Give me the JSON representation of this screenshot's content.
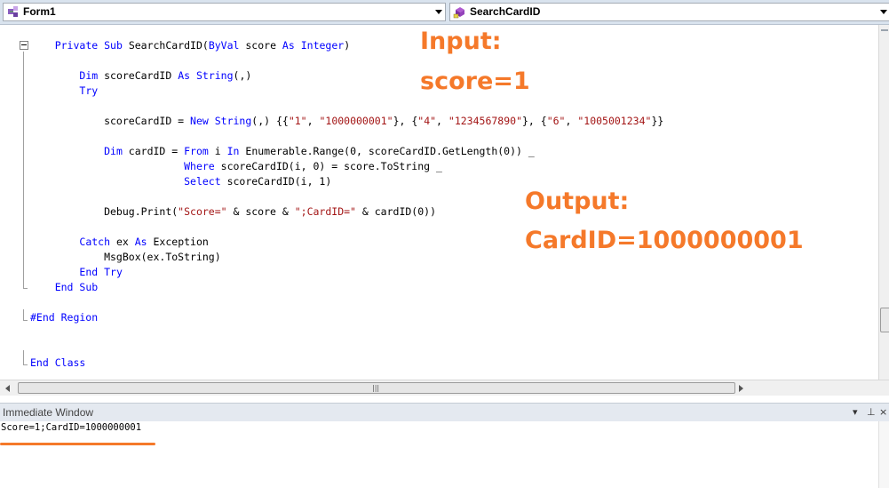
{
  "toolbar": {
    "class_combo": {
      "label": "Form1",
      "icon": "class-icon"
    },
    "method_combo": {
      "label": "SearchCardID",
      "icon": "method-icon"
    }
  },
  "code_lines": [
    [
      {
        "t": "    "
      },
      {
        "t": "Private",
        "c": "kw"
      },
      {
        "t": " "
      },
      {
        "t": "Sub",
        "c": "kw"
      },
      {
        "t": " SearchCardID("
      },
      {
        "t": "ByVal",
        "c": "kw"
      },
      {
        "t": " score "
      },
      {
        "t": "As",
        "c": "kw"
      },
      {
        "t": " "
      },
      {
        "t": "Integer",
        "c": "kw"
      },
      {
        "t": ")"
      }
    ],
    [],
    [
      {
        "t": "        "
      },
      {
        "t": "Dim",
        "c": "kw"
      },
      {
        "t": " scoreCardID "
      },
      {
        "t": "As",
        "c": "kw"
      },
      {
        "t": " "
      },
      {
        "t": "String",
        "c": "kw"
      },
      {
        "t": "(,)"
      }
    ],
    [
      {
        "t": "        "
      },
      {
        "t": "Try",
        "c": "kw"
      }
    ],
    [],
    [
      {
        "t": "            scoreCardID = "
      },
      {
        "t": "New",
        "c": "kw"
      },
      {
        "t": " "
      },
      {
        "t": "String",
        "c": "kw"
      },
      {
        "t": "(,) {{"
      },
      {
        "t": "\"1\"",
        "c": "str"
      },
      {
        "t": ", "
      },
      {
        "t": "\"1000000001\"",
        "c": "str"
      },
      {
        "t": "}, {"
      },
      {
        "t": "\"4\"",
        "c": "str"
      },
      {
        "t": ", "
      },
      {
        "t": "\"1234567890\"",
        "c": "str"
      },
      {
        "t": "}, {"
      },
      {
        "t": "\"6\"",
        "c": "str"
      },
      {
        "t": ", "
      },
      {
        "t": "\"1005001234\"",
        "c": "str"
      },
      {
        "t": "}}"
      }
    ],
    [],
    [
      {
        "t": "            "
      },
      {
        "t": "Dim",
        "c": "kw"
      },
      {
        "t": " cardID = "
      },
      {
        "t": "From",
        "c": "kw"
      },
      {
        "t": " i "
      },
      {
        "t": "In",
        "c": "kw"
      },
      {
        "t": " Enumerable.Range(0, scoreCardID.GetLength(0)) _"
      }
    ],
    [
      {
        "t": "                         "
      },
      {
        "t": "Where",
        "c": "kw"
      },
      {
        "t": " scoreCardID(i, 0) = score.ToString _"
      }
    ],
    [
      {
        "t": "                         "
      },
      {
        "t": "Select",
        "c": "kw"
      },
      {
        "t": " scoreCardID(i, 1)"
      }
    ],
    [],
    [
      {
        "t": "            Debug.Print("
      },
      {
        "t": "\"Score=\"",
        "c": "str"
      },
      {
        "t": " & score & "
      },
      {
        "t": "\";CardID=\"",
        "c": "str"
      },
      {
        "t": " & cardID(0))"
      }
    ],
    [],
    [
      {
        "t": "        "
      },
      {
        "t": "Catch",
        "c": "kw"
      },
      {
        "t": " ex "
      },
      {
        "t": "As",
        "c": "kw"
      },
      {
        "t": " Exception"
      }
    ],
    [
      {
        "t": "            MsgBox(ex.ToString)"
      }
    ],
    [
      {
        "t": "        "
      },
      {
        "t": "End",
        "c": "kw"
      },
      {
        "t": " "
      },
      {
        "t": "Try",
        "c": "kw"
      }
    ],
    [
      {
        "t": "    "
      },
      {
        "t": "End",
        "c": "kw"
      },
      {
        "t": " "
      },
      {
        "t": "Sub",
        "c": "kw"
      }
    ],
    [],
    [
      {
        "t": "#End Region",
        "c": "kw"
      }
    ],
    [],
    [],
    [
      {
        "t": "End",
        "c": "kw"
      },
      {
        "t": " "
      },
      {
        "t": "Class",
        "c": "kw"
      }
    ]
  ],
  "annotations": {
    "input_label": "Input:",
    "input_value": "score=1",
    "output_label": "Output:",
    "output_value": "CardID=1000000001"
  },
  "immediate_window": {
    "title": "Immediate Window",
    "output": "Score=1;CardID=1000000001"
  },
  "colors": {
    "keyword": "#0000ff",
    "string": "#a31515",
    "annotation": "#f5792a"
  }
}
